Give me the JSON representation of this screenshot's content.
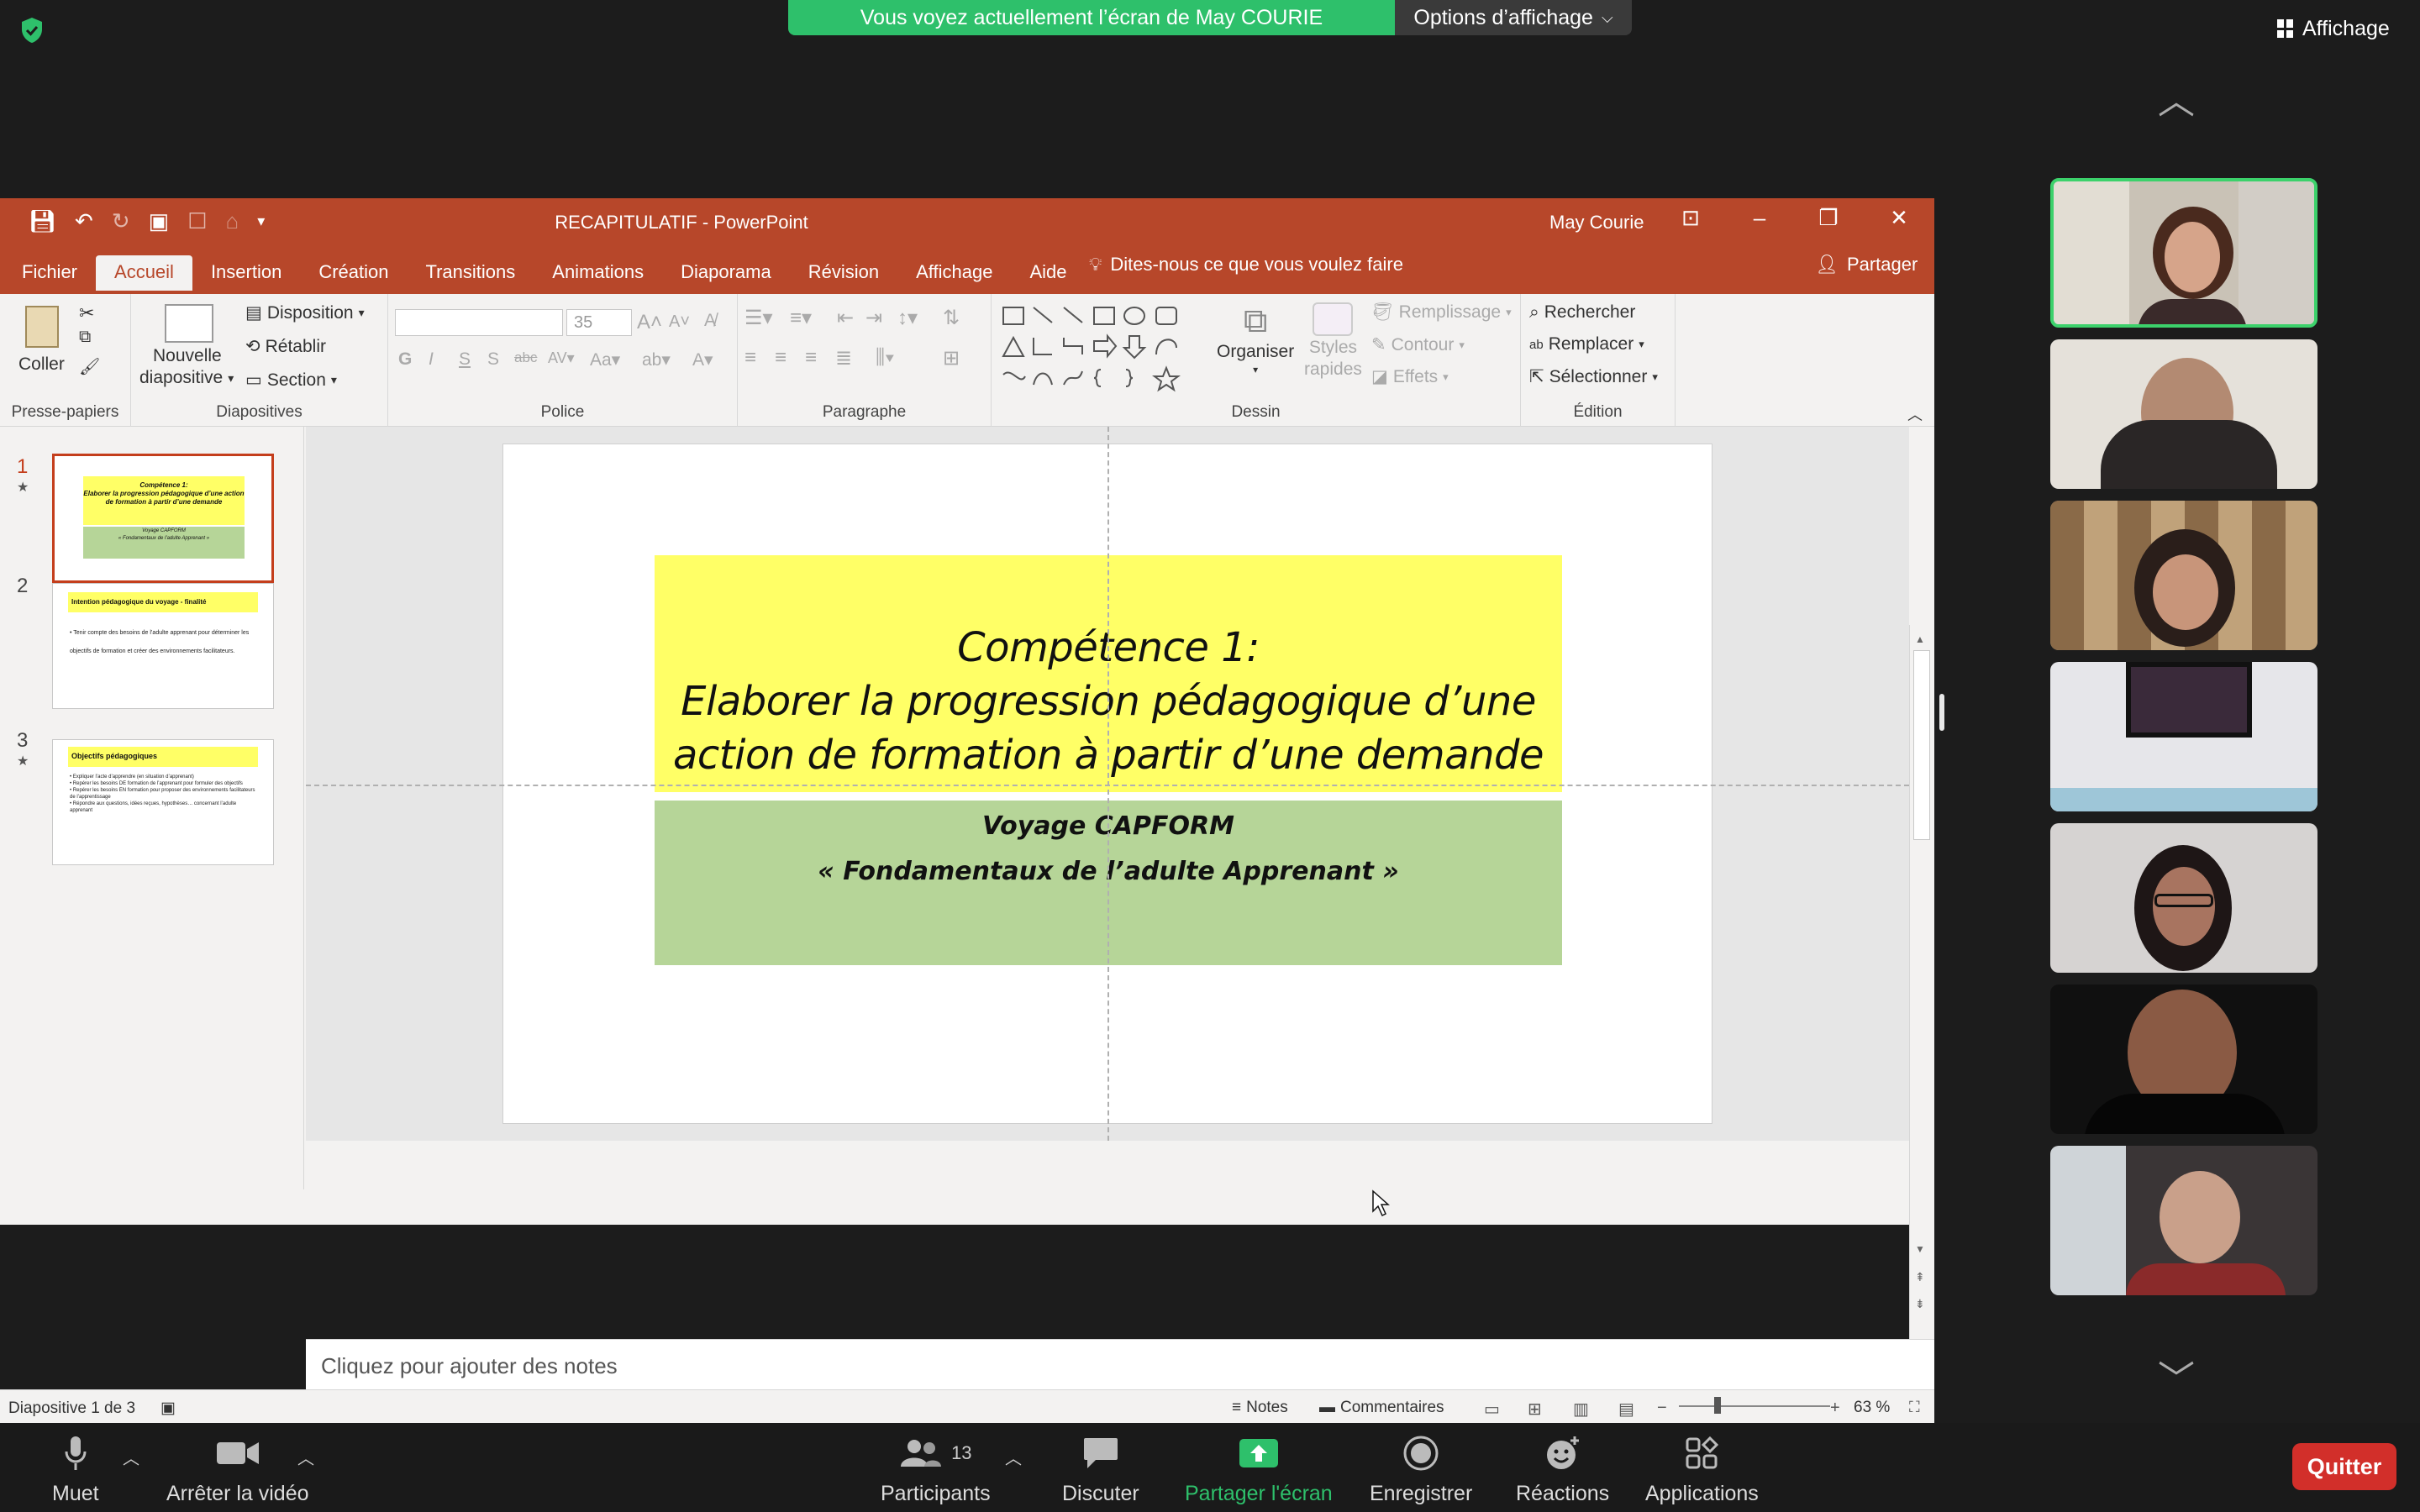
{
  "zoom": {
    "share_banner": "Vous voyez actuellement l’écran de May COURIE",
    "view_options": "Options d’affichage",
    "view_button": "Affichage",
    "participants_count": "13",
    "toolbar": {
      "mute": "Muet",
      "stop_video": "Arrêter la vidéo",
      "participants": "Participants",
      "chat": "Discuter",
      "share_screen": "Partager l'écran",
      "record": "Enregistrer",
      "reactions": "Réactions",
      "apps": "Applications",
      "quit": "Quitter"
    },
    "colors": {
      "green": "#2ec06b",
      "quit": "#d22f2a",
      "active_speaker": "#3cd16b"
    }
  },
  "ppt": {
    "title": "RECAPITULATIF  -  PowerPoint",
    "user": "May Courie",
    "tabs": [
      "Fichier",
      "Accueil",
      "Insertion",
      "Création",
      "Transitions",
      "Animations",
      "Diaporama",
      "Révision",
      "Affichage",
      "Aide"
    ],
    "tell_me": "Dites-nous ce que vous voulez faire",
    "share": "Partager",
    "ribbon": {
      "coller": "Coller",
      "presse_papiers": "Presse-papiers",
      "nouvelle": "Nouvelle",
      "diapositive": "diapositive",
      "disposition": "Disposition",
      "retablir": "Rétablir",
      "section": "Section",
      "diapositives": "Diapositives",
      "font_size": "35",
      "police": "Police",
      "paragraphe": "Paragraphe",
      "organiser": "Organiser",
      "styles": "Styles",
      "rapides": "rapides",
      "remplissage": "Remplissage",
      "contour": "Contour",
      "effets": "Effets",
      "dessin": "Dessin",
      "rechercher": "Rechercher",
      "remplacer": "Remplacer",
      "selectionner": "Sélectionner",
      "edition": "Édition"
    },
    "thumbnails": [
      {
        "num": "1",
        "lines": [
          "Compétence 1:",
          "Elaborer la progression pédagogique d’une action de formation à partir d’une demande"
        ],
        "sub": [
          "Voyage CAPFORM",
          "« Fondamentaux de l’adulte Apprenant »"
        ]
      },
      {
        "num": "2",
        "title": "Intention pédagogique du voyage - finalité",
        "body": "• Tenir compte des besoins de l’adulte apprenant pour déterminer les objectifs de formation et créer des environnements facilitateurs."
      },
      {
        "num": "3",
        "title": "Objectifs pédagogiques",
        "bullets": [
          "• Expliquer l’acte d’apprendre (en situation d’apprenant)",
          "• Repérer les besoins DE formation de l’apprenant pour formuler des objectifs",
          "• Repérer les besoins EN formation pour proposer des environnements facilitateurs de l’apprentissage",
          "• Répondre aux questions, idées reçues, hypothèses… concernant l’adulte apprenant"
        ]
      }
    ],
    "slide": {
      "title_line1": "Compétence 1:",
      "title_line2": "Elaborer la progression pédagogique d’une",
      "title_line3": "action de formation à partir d’une demande",
      "sub_line1": "Voyage CAPFORM",
      "sub_line2": "« Fondamentaux de l’adulte Apprenant »"
    },
    "notes_placeholder": "Cliquez pour ajouter des notes",
    "status": {
      "slide_info": "Diapositive 1 de 3",
      "notes": "Notes",
      "comments": "Commentaires",
      "zoom": "63 %"
    },
    "colors": {
      "brand": "#b7472a",
      "slide_yellow": "#ffff66",
      "slide_green": "#b6d598"
    }
  }
}
